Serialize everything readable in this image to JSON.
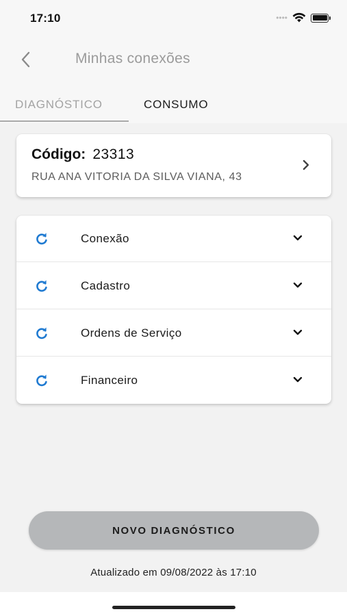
{
  "status_bar": {
    "time": "17:10",
    "signal_icon": "signal-dots-icon",
    "wifi_icon": "wifi-icon",
    "battery_icon": "battery-icon"
  },
  "header": {
    "back_icon": "chevron-left-icon",
    "title": "Minhas conexões"
  },
  "tabs": [
    {
      "label": "DIAGNÓSTICO",
      "active": true
    },
    {
      "label": "CONSUMO",
      "active": false
    }
  ],
  "connection_card": {
    "code_label": "Código:",
    "code_value": "23313",
    "address": "RUA ANA VITORIA DA SILVA VIANA, 43",
    "chevron_icon": "chevron-right-icon"
  },
  "diagnostics": {
    "items": [
      {
        "label": "Conexão",
        "icon": "refresh-icon",
        "expand_icon": "chevron-down-icon"
      },
      {
        "label": "Cadastro",
        "icon": "refresh-icon",
        "expand_icon": "chevron-down-icon"
      },
      {
        "label": "Ordens de Serviço",
        "icon": "refresh-icon",
        "expand_icon": "chevron-down-icon"
      },
      {
        "label": "Financeiro",
        "icon": "refresh-icon",
        "expand_icon": "chevron-down-icon"
      }
    ]
  },
  "actions": {
    "new_diagnostic_label": "NOVO DIAGNÓSTICO"
  },
  "footer": {
    "updated_text": "Atualizado em 09/08/2022 às 17:10"
  },
  "colors": {
    "accent_blue": "#1f7ad1",
    "button_gray": "#b5b7b9",
    "background": "#f2f2f2"
  }
}
